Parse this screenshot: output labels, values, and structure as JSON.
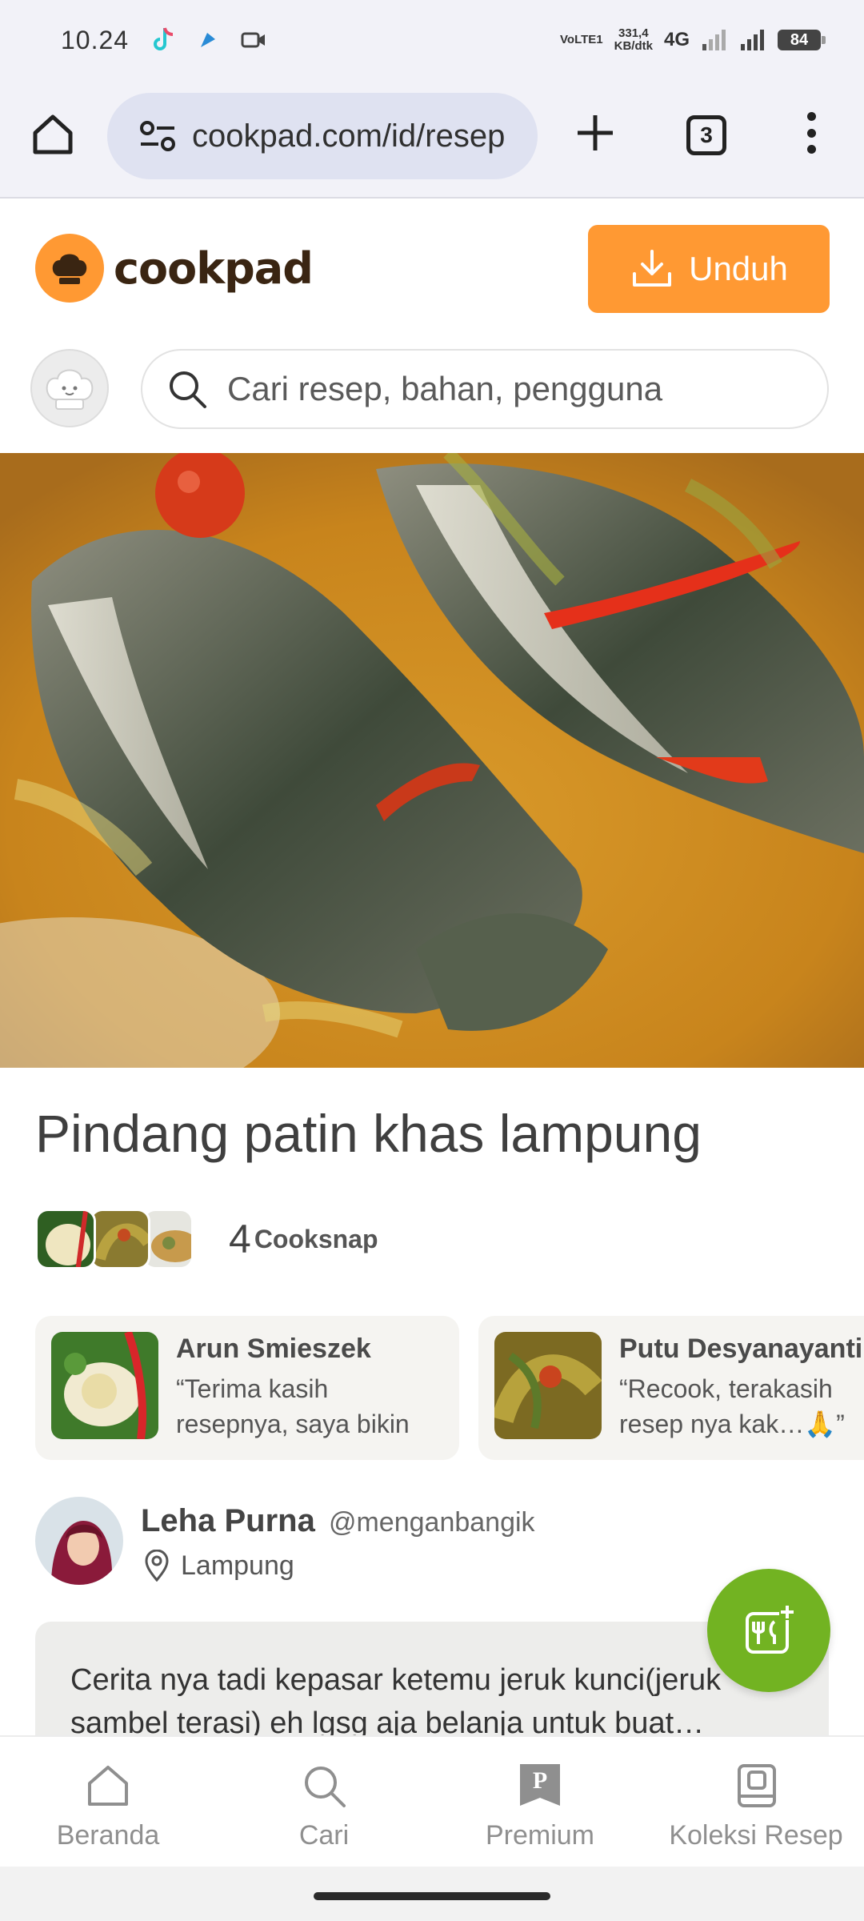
{
  "status_bar": {
    "time": "10.24",
    "network_rate": "331,4",
    "network_unit": "KB/dtk",
    "volte": "VoLTE1",
    "network_type": "4G",
    "battery": "84"
  },
  "browser": {
    "url": "cookpad.com/id/resep",
    "tab_count": "3"
  },
  "header": {
    "logo_text": "cookpad",
    "download_label": "Unduh",
    "search_placeholder": "Cari resep, bahan, pengguna",
    "brand_color": "#ff9933"
  },
  "recipe": {
    "title": "Pindang patin khas lampung",
    "cooksnap_count": "4",
    "cooksnap_label": "Cooksnap",
    "cooksnaps": [
      {
        "name": "Arun Smieszek",
        "quote": "“Terima kasih resepnya, saya bikin versi n…"
      },
      {
        "name": "Putu Desyanayanti",
        "quote": "“Recook, terakasih resep nya kak…🙏”"
      }
    ],
    "author": {
      "name": "Leha Purna",
      "handle": "@menganbangik",
      "location": "Lampung"
    },
    "story": "Cerita nya tadi kepasar ketemu jeruk kunci(jeruk sambel terasi) eh lgsg aja belanja untuk buat…"
  },
  "bottom_nav": {
    "items": [
      {
        "label": "Beranda",
        "icon": "home-icon"
      },
      {
        "label": "Cari",
        "icon": "search-icon"
      },
      {
        "label": "Premium",
        "icon": "premium-icon"
      },
      {
        "label": "Koleksi Resep",
        "icon": "collection-icon"
      }
    ]
  },
  "fab_color": "#72b322"
}
